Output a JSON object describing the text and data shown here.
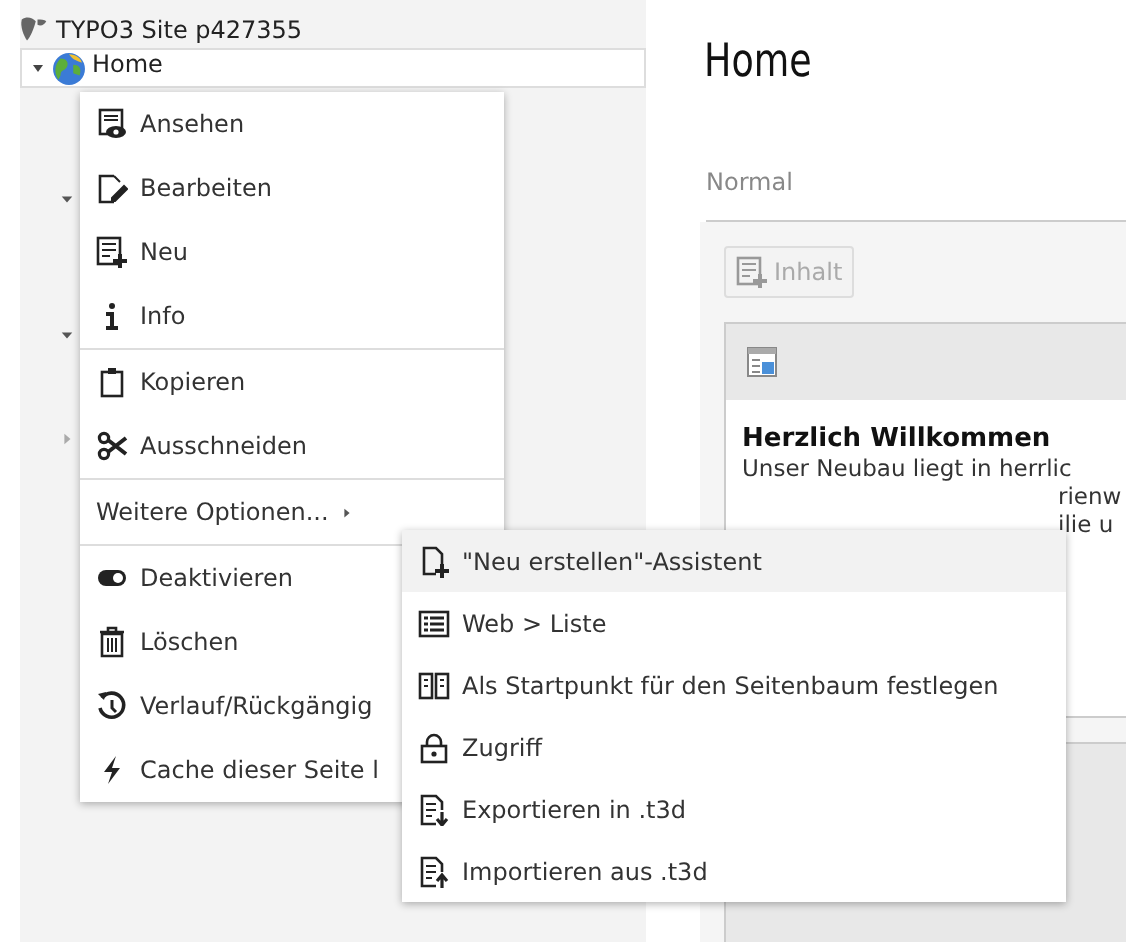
{
  "tree": {
    "site": "TYPO3 Site p427355",
    "home": {
      "label": "Home",
      "expanded": true,
      "children": [
        {
          "expanded": true
        },
        {
          "expanded": true
        },
        {
          "expanded": false
        }
      ]
    }
  },
  "page": {
    "title": "Home",
    "column": "Normal",
    "add_button": "Inhalt",
    "card": {
      "heading": "Herzlich Willkommen",
      "lines": [
        "Unser Neubau liegt in herrlic",
        "rienw",
        "ilie u"
      ]
    }
  },
  "context_menu": {
    "groups": [
      [
        {
          "label": "Ansehen",
          "kind": "action"
        },
        {
          "label": "Bearbeiten",
          "kind": "action"
        },
        {
          "label": "Neu",
          "kind": "action"
        },
        {
          "label": "Info",
          "kind": "action"
        }
      ],
      [
        {
          "label": "Kopieren",
          "kind": "action"
        },
        {
          "label": "Ausschneiden",
          "kind": "action"
        }
      ],
      [
        {
          "label": "Weitere Optionen...",
          "kind": "submenu"
        }
      ],
      [
        {
          "label": "Deaktivieren",
          "kind": "action"
        },
        {
          "label": "Löschen",
          "kind": "action"
        },
        {
          "label": "Verlauf/Rückgängig",
          "kind": "action"
        },
        {
          "label": "Cache dieser Seite l",
          "kind": "action"
        }
      ]
    ]
  },
  "submenu": {
    "items": [
      {
        "label": "\"Neu erstellen\"-Assistent",
        "selected": true
      },
      {
        "label": "Web > Liste",
        "selected": false
      },
      {
        "label": "Als Startpunkt für den Seitenbaum festlegen",
        "selected": false
      },
      {
        "label": "Zugriff",
        "selected": false
      },
      {
        "label": "Exportieren in .t3d",
        "selected": false
      },
      {
        "label": "Importieren aus .t3d",
        "selected": false
      }
    ]
  }
}
